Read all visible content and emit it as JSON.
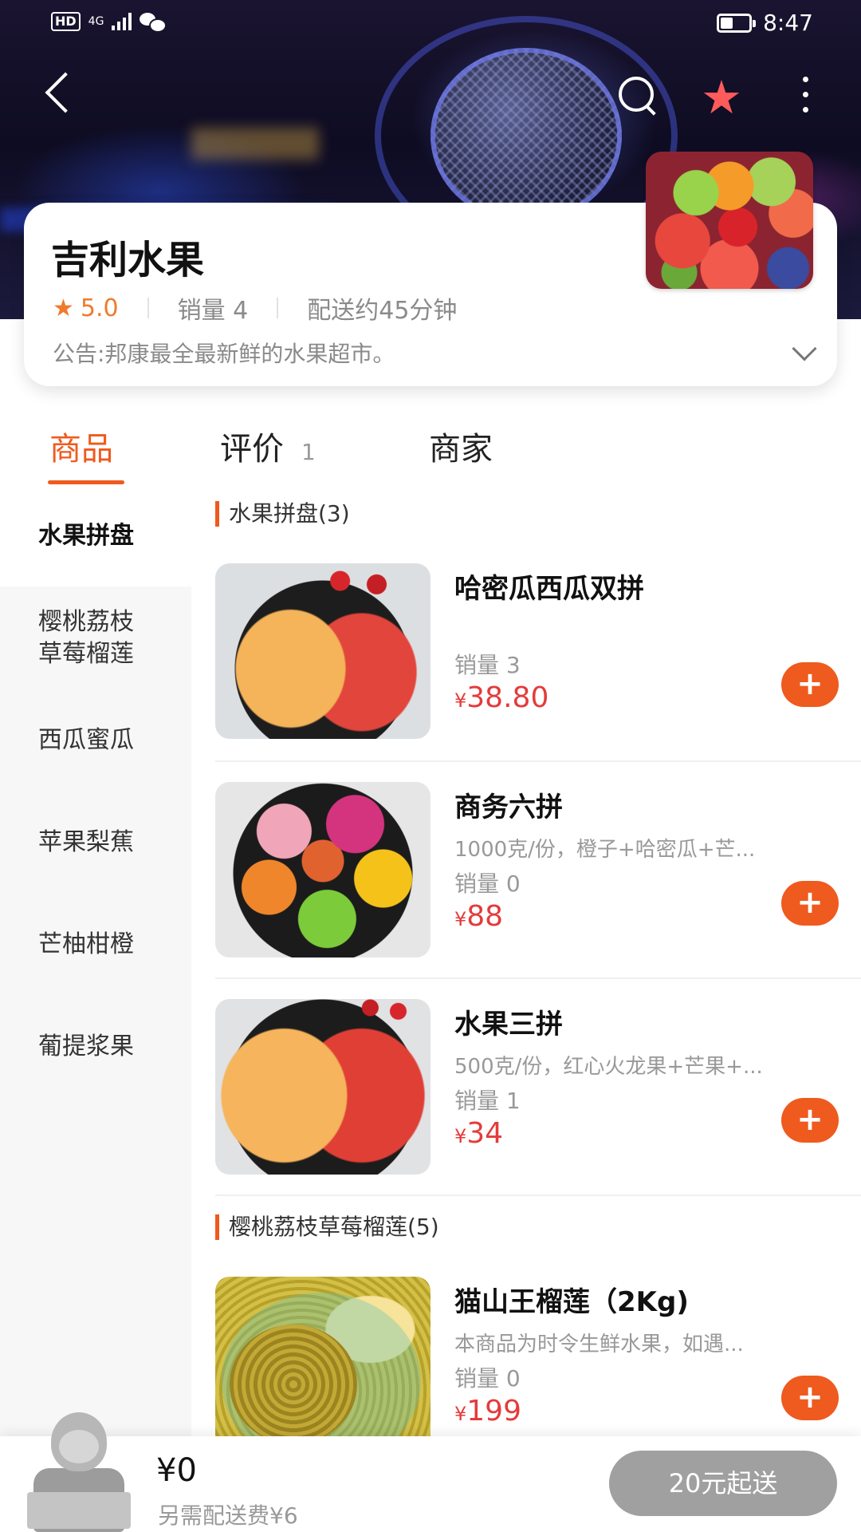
{
  "status_bar": {
    "hd": "HD",
    "network": "4G",
    "time": "8:47"
  },
  "shop": {
    "name": "吉利水果",
    "rating": "5.0",
    "sales": "销量 4",
    "delivery_time": "配送约45分钟",
    "notice": "公告:邦康最全最新鲜的水果超市。"
  },
  "tabs": [
    {
      "label": "商品",
      "count": ""
    },
    {
      "label": "评价",
      "count": "1"
    },
    {
      "label": "商家",
      "count": ""
    }
  ],
  "categories": [
    {
      "line1": "水果拼盘",
      "line2": ""
    },
    {
      "line1": "樱桃荔枝",
      "line2": "草莓榴莲"
    },
    {
      "line1": "西瓜蜜瓜",
      "line2": ""
    },
    {
      "line1": "苹果梨蕉",
      "line2": ""
    },
    {
      "line1": "芒柚柑橙",
      "line2": ""
    },
    {
      "line1": "葡提浆果",
      "line2": ""
    }
  ],
  "sections": [
    {
      "title": "水果拼盘(3)"
    },
    {
      "title": "樱桃荔枝草莓榴莲(5)"
    }
  ],
  "products": [
    {
      "name": "哈密瓜西瓜双拼",
      "desc": "",
      "sales": "销量 3",
      "currency": "¥",
      "price": "38.80"
    },
    {
      "name": "商务六拼",
      "desc": "1000克/份，橙子+哈密瓜+芒...",
      "sales": "销量 0",
      "currency": "¥",
      "price": "88"
    },
    {
      "name": "水果三拼",
      "desc": "500克/份，红心火龙果+芒果+...",
      "sales": "销量 1",
      "currency": "¥",
      "price": "34"
    },
    {
      "name": "猫山王榴莲（2Kg)",
      "desc": "本商品为时令生鲜水果，如遇...",
      "sales": "销量 0",
      "currency": "¥",
      "price": "199"
    }
  ],
  "add_symbol": "+",
  "cart": {
    "total": "¥0",
    "delivery_fee": "另需配送费¥6",
    "min_order": "20元起送"
  },
  "icons": {
    "back": "back-arrow-icon",
    "search": "search-icon",
    "favorite": "star-icon",
    "more": "more-vertical-icon",
    "rating": "star-icon",
    "expand": "chevron-down-icon"
  },
  "colors": {
    "accent": "#ef5a1e",
    "price": "#e43b3b",
    "rating": "#f07a2c",
    "favorite": "#ff5b5b",
    "disabled_button": "#a0a0a0"
  }
}
